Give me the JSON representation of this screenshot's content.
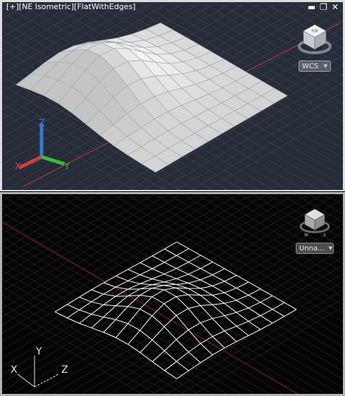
{
  "viewport_top": {
    "label": "[+][NE Isometric][FlatWithEdges]",
    "window_controls": {
      "minimize": "▬",
      "restore": "❐",
      "close": "✕"
    },
    "ucs_button": "WCS",
    "axis_labels": {
      "x": "X",
      "y": "Y",
      "z": "Z"
    },
    "visual_style": "FlatWithEdges",
    "colors": {
      "background": "#262c38",
      "grid": "#3d4352",
      "surface": "#e8e8e8",
      "x_axis": "#d04040",
      "y_axis": "#3cbc3c",
      "z_axis": "#3a78c8"
    }
  },
  "viewport_bottom": {
    "ucs_button": "Unna...",
    "axis_labels": {
      "x": "X",
      "y": "Y",
      "z": "Z"
    },
    "visual_style": "Wireframe",
    "colors": {
      "background": "#040404",
      "grid": "#2a2a2a",
      "wire": "#ffffff",
      "red_axis": "#8a1c1c"
    }
  }
}
